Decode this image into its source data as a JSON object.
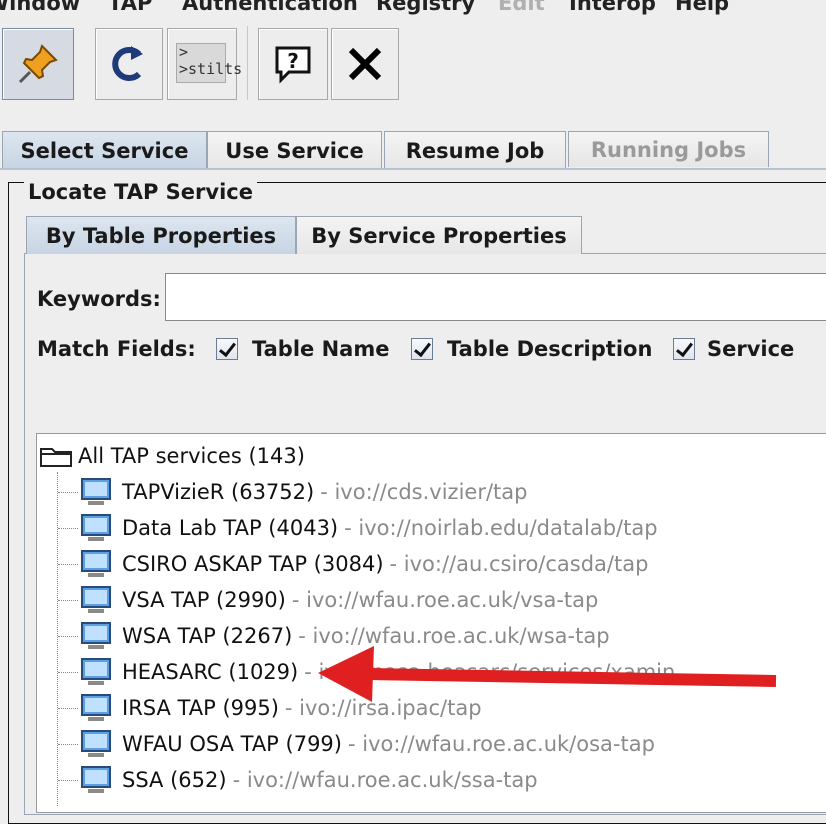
{
  "menu": [
    "Window",
    "TAP",
    "Authentication",
    "Registry",
    "Edit",
    "Interop",
    "Help"
  ],
  "toolbar": {
    "buttons": [
      "pin-icon",
      "reload-icon",
      "stilts-icon",
      "help-icon",
      "close-icon"
    ],
    "stilts_label_top": ">",
    "stilts_label": ">stilts"
  },
  "tabs": [
    "Select Service",
    "Use Service",
    "Resume Job",
    "Running Jobs"
  ],
  "panel": {
    "title": "Locate TAP Service",
    "subtabs": [
      "By Table Properties",
      "By Service Properties"
    ],
    "keywords_label": "Keywords:",
    "keywords_value": "",
    "match_fields_label": "Match Fields:",
    "match_fields": [
      {
        "label": "Table Name",
        "checked": true
      },
      {
        "label": "Table Description",
        "checked": true
      },
      {
        "label": "Service",
        "checked": true
      }
    ]
  },
  "tree": {
    "root": "All TAP services (143)",
    "services": [
      {
        "name": "TAPVizieR (63752)",
        "ivo": "- ivo://cds.vizier/tap"
      },
      {
        "name": "Data Lab TAP (4043)",
        "ivo": "- ivo://noirlab.edu/datalab/tap"
      },
      {
        "name": "CSIRO ASKAP TAP (3084)",
        "ivo": "- ivo://au.csiro/casda/tap"
      },
      {
        "name": "VSA TAP (2990)",
        "ivo": "- ivo://wfau.roe.ac.uk/vsa-tap"
      },
      {
        "name": "WSA TAP (2267)",
        "ivo": "- ivo://wfau.roe.ac.uk/wsa-tap"
      },
      {
        "name": "HEASARC (1029)",
        "ivo": "- ivo://nasa.heasarc/services/xamin"
      },
      {
        "name": "IRSA TAP (995)",
        "ivo": "- ivo://irsa.ipac/tap"
      },
      {
        "name": "WFAU OSA TAP (799)",
        "ivo": "- ivo://wfau.roe.ac.uk/osa-tap"
      },
      {
        "name": "SSA (652)",
        "ivo": "- ivo://wfau.roe.ac.uk/ssa-tap"
      }
    ]
  },
  "annotation": {
    "color": "#e02020"
  }
}
